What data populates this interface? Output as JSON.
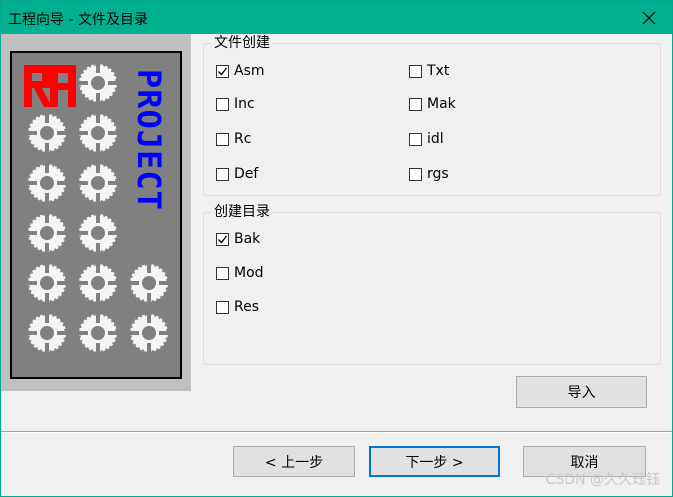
{
  "window": {
    "title": "工程向导 - 文件及目录",
    "close_icon": "close-icon"
  },
  "banner": {
    "logo_text": "PROJECT"
  },
  "file_group": {
    "title": "文件创建",
    "items": [
      {
        "label": "Asm",
        "checked": true
      },
      {
        "label": "Txt",
        "checked": false
      },
      {
        "label": "Inc",
        "checked": false
      },
      {
        "label": "Mak",
        "checked": false
      },
      {
        "label": "Rc",
        "checked": false
      },
      {
        "label": "idl",
        "checked": false
      },
      {
        "label": "Def",
        "checked": false
      },
      {
        "label": "rgs",
        "checked": false
      }
    ]
  },
  "dir_group": {
    "title": "创建目录",
    "items": [
      {
        "label": "Bak",
        "checked": true
      },
      {
        "label": "Mod",
        "checked": false
      },
      {
        "label": "Res",
        "checked": false
      }
    ]
  },
  "buttons": {
    "import": "导入",
    "prev": "< 上一步",
    "next": "下一步 >",
    "cancel": "取消"
  },
  "watermark": "CSDN @久久珏钰"
}
